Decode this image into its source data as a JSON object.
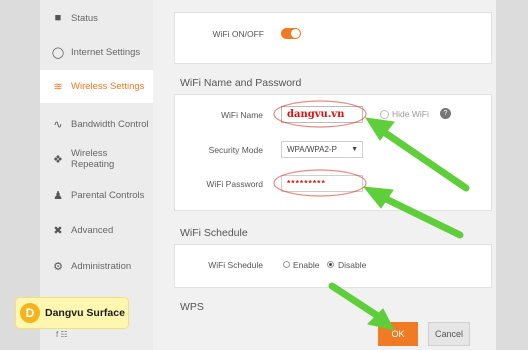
{
  "sidebar": {
    "items": [
      {
        "label": "Status",
        "icon": "status-icon"
      },
      {
        "label": "Internet Settings",
        "icon": "globe-icon"
      },
      {
        "label": "Wireless Settings",
        "icon": "wifi-icon"
      },
      {
        "label": "Bandwidth Control",
        "icon": "chart-line-icon"
      },
      {
        "label": "Wireless Repeating",
        "icon": "repeater-icon"
      },
      {
        "label": "Parental Controls",
        "icon": "person-icon"
      },
      {
        "label": "Advanced",
        "icon": "tools-icon"
      },
      {
        "label": "Administration",
        "icon": "gear-icon"
      }
    ],
    "active_index": 2
  },
  "wifi_toggle": {
    "label": "WiFi ON/OFF",
    "on": true
  },
  "name_password": {
    "title": "WiFi Name and Password",
    "name_label": "WiFi Name",
    "name_value": "dangvu.vn",
    "hide_label": "Hide WiFi",
    "help_glyph": "?",
    "mode_label": "Security Mode",
    "mode_value": "WPA/WPA2-P",
    "password_label": "WiFi Password",
    "password_value": "*********"
  },
  "schedule": {
    "title": "WiFi Schedule",
    "label": "WiFi Schedule",
    "enable": "Enable",
    "disable": "Disable",
    "selected": "Disable"
  },
  "wps": {
    "title": "WPS"
  },
  "buttons": {
    "ok": "OK",
    "cancel": "Cancel"
  },
  "watermark": {
    "logo_letter": "D",
    "text": "Dangvu Surface"
  },
  "footer": {
    "social": "f  ☷"
  },
  "colors": {
    "accent": "#f07b24",
    "arrow": "#5ecf3a"
  }
}
